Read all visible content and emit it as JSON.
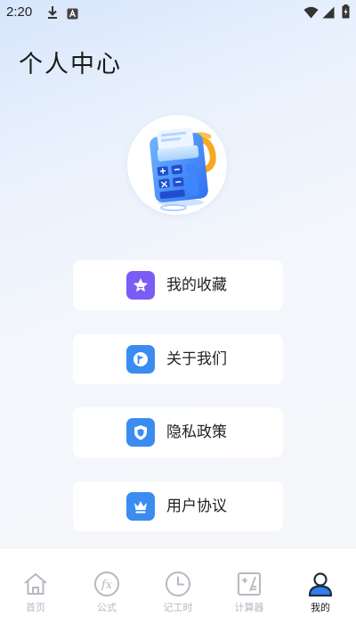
{
  "status_bar": {
    "time": "2:20",
    "icons": [
      "download-icon",
      "a-badge-icon",
      "wifi-icon",
      "signal-icon",
      "battery-charging-icon"
    ]
  },
  "page": {
    "title": "个人中心",
    "avatar_icon": "calculator-illustration"
  },
  "menu": [
    {
      "label": "我的收藏",
      "icon": "star-icon",
      "color": "#7b5cf5"
    },
    {
      "label": "关于我们",
      "icon": "flag-icon",
      "color": "#3b8cf0"
    },
    {
      "label": "隐私政策",
      "icon": "shield-icon",
      "color": "#3b8cf0"
    },
    {
      "label": "用户协议",
      "icon": "crown-icon",
      "color": "#3b8cf0"
    }
  ],
  "bottom_nav": {
    "items": [
      {
        "label": "首页",
        "icon": "home-icon",
        "active": false
      },
      {
        "label": "公式",
        "icon": "fx-icon",
        "active": false
      },
      {
        "label": "记工时",
        "icon": "clock-icon",
        "active": false
      },
      {
        "label": "计算器",
        "icon": "calculator-icon",
        "active": false
      },
      {
        "label": "我的",
        "icon": "user-icon",
        "active": true
      }
    ],
    "active_color": "#2f80ed",
    "inactive_color": "#b5b9c0"
  }
}
